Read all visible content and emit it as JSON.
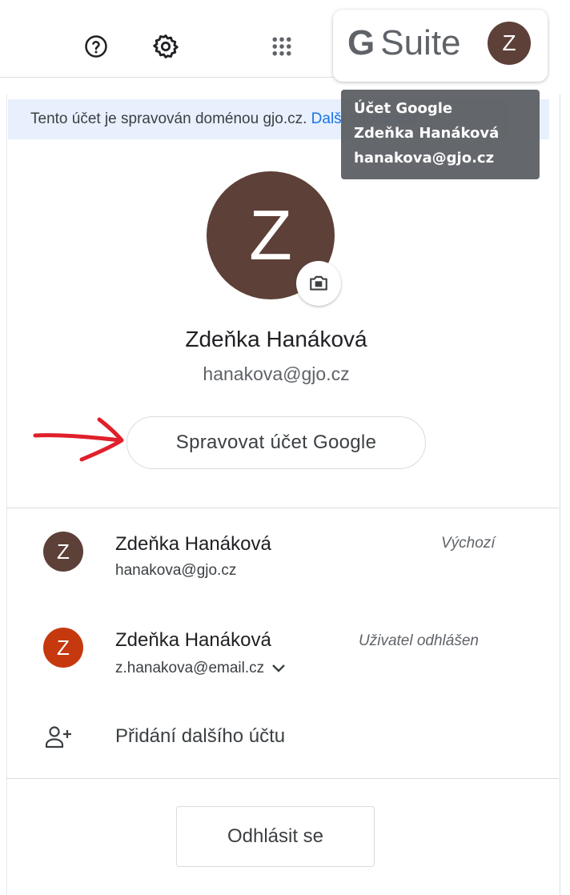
{
  "header": {
    "help_icon": "help-circle-icon",
    "settings_icon": "gear-icon",
    "apps_icon": "apps-grid-icon",
    "brand_g": "G",
    "brand_word": "Suite",
    "avatar_letter": "Z"
  },
  "tooltip": {
    "line1": "Účet Google",
    "line2": "Zdeňka Hanáková",
    "line3": "hanakova@gjo.cz"
  },
  "banner": {
    "text": "Tento účet je spravován doménou gjo.cz.",
    "link": "Další informace"
  },
  "profile": {
    "avatar_letter": "Z",
    "camera_icon": "camera-icon",
    "name": "Zdeňka Hanáková",
    "email": "hanakova@gjo.cz",
    "manage_label": "Spravovat účet Google"
  },
  "accounts": [
    {
      "avatar_letter": "Z",
      "avatar_color": "#5d4037",
      "name": "Zdeňka Hanáková",
      "email": "hanakova@gjo.cz",
      "status": "Výchozí"
    },
    {
      "avatar_letter": "Z",
      "avatar_color": "#c6390f",
      "name": "Zdeňka Hanáková",
      "email": "z.hanakova@email.cz",
      "status": "Uživatel odhlášen"
    }
  ],
  "add_account": {
    "icon": "add-person-icon",
    "label": "Přidání dalšího účtu"
  },
  "signout_label": "Odhlásit se",
  "colors": {
    "avatar_brown": "#5d4037",
    "avatar_red": "#c6390f",
    "banner_bg": "#e8f0fe",
    "tooltip_bg": "#5f6368",
    "annotation_arrow": "#e0202a"
  }
}
